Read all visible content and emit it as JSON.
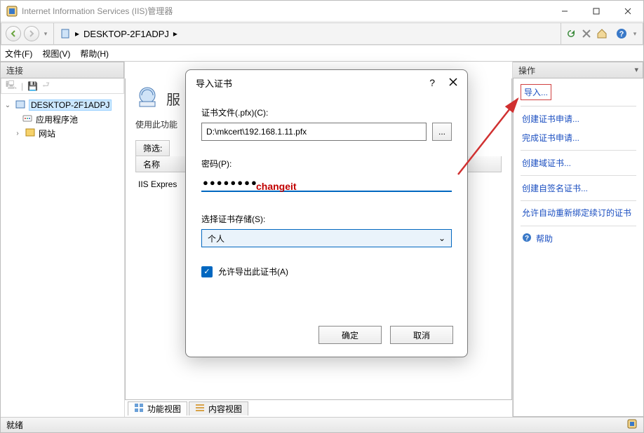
{
  "titlebar": {
    "title": "Internet Information Services (IIS)管理器"
  },
  "address": {
    "host": "DESKTOP-2F1ADPJ",
    "sep": "▸"
  },
  "menubar": {
    "file": "文件(F)",
    "view": "视图(V)",
    "help": "帮助(H)"
  },
  "leftpane": {
    "header": "连接",
    "root": "DESKTOP-2F1ADPJ",
    "app_pools": "应用程序池",
    "sites": "网站"
  },
  "centerpane": {
    "title_prefix": "服",
    "desc": "使用此功能",
    "filter_label": "筛选:",
    "col_name": "名称",
    "row1": "IIS Expres"
  },
  "footer_tabs": {
    "features": "功能视图",
    "content": "内容视图"
  },
  "rightpane": {
    "header": "操作",
    "import": "导入...",
    "create_req": "创建证书申请...",
    "complete_req": "完成证书申请...",
    "create_domain": "创建域证书...",
    "create_selfsigned": "创建自签名证书...",
    "allow_rebind": "允许自动重新绑定续订的证书",
    "help": "帮助"
  },
  "status": {
    "ready": "就绪"
  },
  "dialog": {
    "title": "导入证书",
    "help_mark": "?",
    "file_label": "证书文件(.pfx)(C):",
    "file_value": "D:\\mkcert\\192.168.1.11.pfx",
    "browse": "...",
    "pwd_label": "密码(P):",
    "pwd_masked": "●●●●●●●●",
    "pwd_note": "changeit",
    "store_label": "选择证书存储(S):",
    "store_value": "个人",
    "allow_export": "允许导出此证书(A)",
    "ok": "确定",
    "cancel": "取消"
  }
}
